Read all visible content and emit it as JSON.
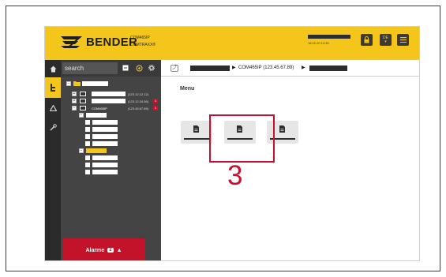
{
  "header": {
    "logo_text": "BENDER",
    "device_line1": "COM465IP",
    "device_line2": "COMTRAXX®",
    "datetime": "18.02.20 13:30",
    "language": "DE"
  },
  "sidebar": {
    "search_placeholder": "search",
    "nav_items": [
      "home-icon",
      "tree-icon",
      "alarm-triangle-icon",
      "tools-icon"
    ]
  },
  "tree": {
    "items": [
      {
        "ip": "(123.12.12.12)"
      },
      {
        "ip": "(123.12.34.56)",
        "badge": "1"
      },
      {
        "label": "COM465IP",
        "ip": "(123.45.67.89)",
        "badge": "1"
      }
    ]
  },
  "alarm": {
    "label": "Alarme",
    "count": "2",
    "icon": "▲"
  },
  "breadcrumb": {
    "device": "COM465IP (123.45.67.89)",
    "separator": "▶",
    "up_icon": "⤴"
  },
  "content": {
    "title": "Menu"
  },
  "callout": {
    "number": "3"
  },
  "colors": {
    "header": "#f4c61b",
    "sidebar": "#444444",
    "alarm": "#c2132a",
    "highlight": "#c8102e"
  }
}
